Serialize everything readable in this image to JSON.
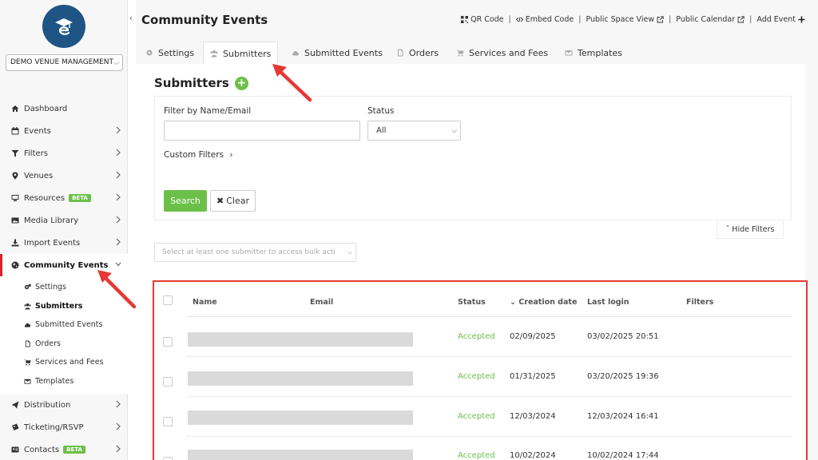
{
  "sidebar": {
    "venue": "DEMO VENUE MANAGEMENT",
    "items": [
      {
        "label": "Dashboard",
        "icon": "home-icon",
        "chevron": false
      },
      {
        "label": "Events",
        "icon": "calendar-icon",
        "chevron": true
      },
      {
        "label": "Filters",
        "icon": "filter-icon",
        "chevron": true
      },
      {
        "label": "Venues",
        "icon": "map-pin-icon",
        "chevron": true
      },
      {
        "label": "Resources",
        "icon": "monitor-icon",
        "chevron": true,
        "badge": "BETA"
      },
      {
        "label": "Media Library",
        "icon": "image-icon",
        "chevron": true
      },
      {
        "label": "Import Events",
        "icon": "download-icon",
        "chevron": true
      },
      {
        "label": "Community Events",
        "icon": "globe-icon",
        "chevron": true
      }
    ],
    "sub_items": [
      {
        "label": "Settings",
        "icon": "cogs-icon"
      },
      {
        "label": "Submitters",
        "icon": "users-icon"
      },
      {
        "label": "Submitted Events",
        "icon": "cloud-upload-icon"
      },
      {
        "label": "Orders",
        "icon": "file-icon"
      },
      {
        "label": "Services and Fees",
        "icon": "cart-icon"
      },
      {
        "label": "Templates",
        "icon": "envelope-icon"
      }
    ],
    "items_after": [
      {
        "label": "Distribution",
        "icon": "paper-plane-icon",
        "chevron": true
      },
      {
        "label": "Ticketing/RSVP",
        "icon": "ticket-icon",
        "chevron": true
      },
      {
        "label": "Contacts",
        "icon": "contact-card-icon",
        "chevron": true,
        "badge": "BETA"
      }
    ]
  },
  "header": {
    "title": "Community Events",
    "links": {
      "qr": "QR Code",
      "embed": "Embed Code",
      "public_space": "Public Space View",
      "public_calendar": "Public Calendar",
      "add_event": "Add Event"
    }
  },
  "tabs": [
    {
      "label": "Settings",
      "icon": "gear-icon"
    },
    {
      "label": "Submitters",
      "icon": "users-icon"
    },
    {
      "label": "Submitted Events",
      "icon": "cloud-upload-icon"
    },
    {
      "label": "Orders",
      "icon": "file-icon"
    },
    {
      "label": "Services and Fees",
      "icon": "cart-icon"
    },
    {
      "label": "Templates",
      "icon": "envelope-icon"
    }
  ],
  "active_tab": "Submitters",
  "section": {
    "title": "Submitters"
  },
  "filters": {
    "name_label": "Filter by Name/Email",
    "name_value": "",
    "status_label": "Status",
    "status_value": "All",
    "custom_filters": "Custom Filters",
    "search_btn": "Search",
    "clear_btn": "Clear",
    "hide_filters": "Hide Filters"
  },
  "bulk": {
    "placeholder": "Select at least one submitter to access bulk acti"
  },
  "table": {
    "columns": {
      "name": "Name",
      "email": "Email",
      "status": "Status",
      "created": "Creation date",
      "last_login": "Last login",
      "filters": "Filters"
    },
    "rows": [
      {
        "status": "Accepted",
        "created": "02/09/2025",
        "last_login": "03/02/2025 20:51"
      },
      {
        "status": "Accepted",
        "created": "01/31/2025",
        "last_login": "03/20/2025 19:36"
      },
      {
        "status": "Accepted",
        "created": "12/03/2024",
        "last_login": "12/03/2024 16:41"
      },
      {
        "status": "Accepted",
        "created": "10/02/2024",
        "last_login": "10/02/2024 17:44"
      }
    ]
  },
  "colors": {
    "accent_green": "#6cc04a",
    "highlight_red": "#e53935",
    "logo_blue": "#1f5585"
  }
}
